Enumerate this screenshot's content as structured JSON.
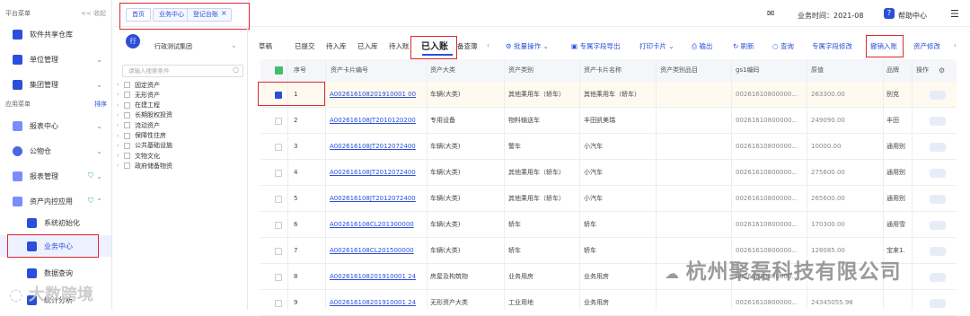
{
  "sidebar": {
    "platform_menu": "平台菜单",
    "collapse": "<< 收起",
    "app_menu": "应用菜单",
    "sort": "排序",
    "items": [
      {
        "label": "软件共享仓库",
        "icon": "cube-icon"
      },
      {
        "label": "单位管理",
        "icon": "cube-icon"
      },
      {
        "label": "集团管理",
        "icon": "building-icon"
      },
      {
        "label": "报表中心",
        "icon": "report-icon"
      },
      {
        "label": "公物仓",
        "icon": "warehouse-icon"
      },
      {
        "label": "报表管理",
        "icon": "report-icon"
      },
      {
        "label": "资产内控应用",
        "icon": "asset-icon"
      },
      {
        "label": "系统初始化",
        "icon": "init-icon"
      },
      {
        "label": "业务中心",
        "icon": "business-icon"
      },
      {
        "label": "数据查询",
        "icon": "query-icon"
      },
      {
        "label": "统计分析",
        "icon": "stats-icon"
      }
    ]
  },
  "topbar": {
    "tabs": [
      "首页",
      "业务中心",
      "登记台账"
    ],
    "tab_close": "×",
    "business_time": "业务时间：2021-08",
    "help": "帮助中心"
  },
  "tree": {
    "org_badge": "行",
    "org_name": "行政测试集团",
    "search_placeholder": "请输入搜索条件",
    "items": [
      "固定资产",
      "无形资产",
      "在建工程",
      "长期股权投资",
      "流动资产",
      "保障性住房",
      "公共基础设施",
      "文物文化",
      "政府储备物资"
    ]
  },
  "toolbar": {
    "status_tabs": [
      "草稿",
      "已提交",
      "待入库",
      "已入库",
      "待入账",
      "已入账",
      "备查簿"
    ],
    "actions": [
      "批量操作",
      "专属字段导出",
      "打印卡片",
      "输出",
      "刷新",
      "查询",
      "专属字段修改",
      "撤销入账",
      "资产修改"
    ]
  },
  "table": {
    "headers": [
      "序号",
      "资产卡片编号",
      "资产大类",
      "资产类别",
      "资产卡片名称",
      "资产类别品目",
      "gs1编码",
      "原值",
      "品牌",
      "操作"
    ],
    "rows": [
      {
        "no": "1",
        "code": "A002616108201910001 00",
        "major": "车辆(大类)",
        "cat": "其他乘用车（轿车）",
        "name": "其他乘用车（轿车）",
        "item": "",
        "gs1": "00261610800000...",
        "value": "263300.00",
        "brand": "别克",
        "checked": true
      },
      {
        "no": "2",
        "code": "A002616108JT2010120200",
        "major": "专用设备",
        "cat": "物料输送车",
        "name": "丰田凯美瑞",
        "item": "",
        "gs1": "00261610800000...",
        "value": "249090.00",
        "brand": "丰田",
        "checked": false
      },
      {
        "no": "3",
        "code": "A002616108JT2012072400",
        "major": "车辆(大类)",
        "cat": "警车",
        "name": "小汽车",
        "item": "",
        "gs1": "00261610800000...",
        "value": "10000.00",
        "brand": "通用别",
        "checked": false
      },
      {
        "no": "4",
        "code": "A002616108JT2012072400",
        "major": "车辆(大类)",
        "cat": "其他乘用车（轿车）",
        "name": "小汽车",
        "item": "",
        "gs1": "00261610800000...",
        "value": "275600.00",
        "brand": "通用别",
        "checked": false
      },
      {
        "no": "5",
        "code": "A002616108JT2012072400",
        "major": "车辆(大类)",
        "cat": "其他乘用车（轿车）",
        "name": "小汽车",
        "item": "",
        "gs1": "00261610800000...",
        "value": "265600.00",
        "brand": "通用别",
        "checked": false
      },
      {
        "no": "6",
        "code": "A002616108CL201300000",
        "major": "车辆(大类)",
        "cat": "轿车",
        "name": "轿车",
        "item": "",
        "gs1": "00261610800000...",
        "value": "170300.00",
        "brand": "通用雪",
        "checked": false
      },
      {
        "no": "7",
        "code": "A002616108CL201500000",
        "major": "车辆(大类)",
        "cat": "轿车",
        "name": "轿车",
        "item": "",
        "gs1": "00261610800000...",
        "value": "128085.00",
        "brand": "宝来1.",
        "checked": false
      },
      {
        "no": "8",
        "code": "A002616108201910001 24",
        "major": "房屋及构筑物",
        "cat": "业务用房",
        "name": "业务用房",
        "item": "",
        "gs1": "00261610800000...",
        "value": "",
        "brand": "",
        "checked": false
      },
      {
        "no": "9",
        "code": "A002616108201910001 24",
        "major": "无形资产大类",
        "cat": "工业用地",
        "name": "业务用房",
        "item": "",
        "gs1": "00261610800000...",
        "value": "24345055.98",
        "brand": "",
        "checked": false
      }
    ]
  },
  "watermarks": {
    "company": "杭州聚磊科技有限公司",
    "brand": "大数跨境"
  }
}
